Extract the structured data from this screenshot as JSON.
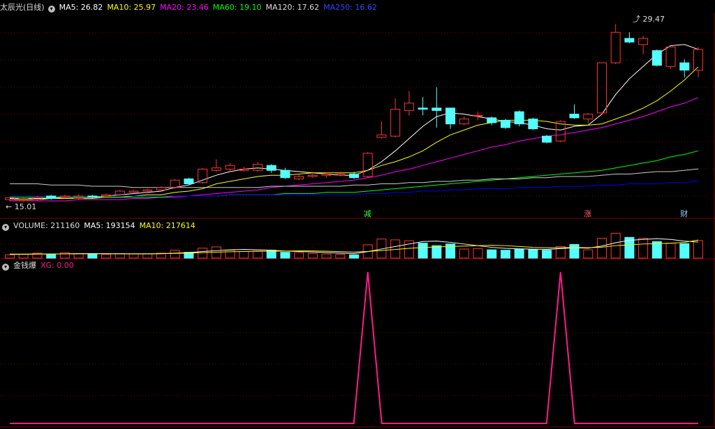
{
  "colors": {
    "bg": "#000000",
    "up": "#ff3232",
    "down": "#54ffff",
    "grid": "#7a0000",
    "ma5": "#ffffff",
    "ma10": "#ffff00",
    "ma20": "#ff00ff",
    "ma60": "#00ff00",
    "ma120": "#cccccc",
    "ma250": "#0000ff",
    "xg": "#ff1a8c",
    "evt_green": "#33ff33",
    "evt_red": "#ff6666",
    "evt_cyan": "#88ccff"
  },
  "price_header": {
    "title": "太辰光(日线)",
    "ma5": "MA5: 26.82",
    "ma10": "MA10: 25.97",
    "ma20": "MA20: 23.46",
    "ma60": "MA60: 19.10",
    "ma120": "MA120: 17.62",
    "ma250": "MA250: 16.62"
  },
  "volume_header": {
    "label": "VOLUME: 211160",
    "ma5": "MA5: 193154",
    "ma10": "MA10: 217614"
  },
  "indicator_header": {
    "label": "金钱爆",
    "xg": "XG: 0.00"
  },
  "annotations": {
    "high": "29.47",
    "low": "15.01"
  },
  "events": [
    {
      "label": "减",
      "index": 26,
      "color": "evt_green"
    },
    {
      "label": "涨",
      "index": 42,
      "color": "evt_red"
    },
    {
      "label": "财",
      "index": 49,
      "color": "evt_cyan"
    }
  ],
  "chart_data": {
    "type": "candlestick",
    "price_range": [
      14.6,
      30.3
    ],
    "volume_range": [
      0,
      320000
    ],
    "xg_range": [
      0,
      1
    ],
    "candles": [
      [
        15.1,
        15.25,
        14.95,
        15.3
      ],
      [
        15.0,
        15.2,
        14.9,
        15.3
      ],
      [
        15.1,
        15.3,
        15.0,
        15.4
      ],
      [
        15.4,
        15.2,
        15.1,
        15.5
      ],
      [
        15.3,
        15.4,
        15.2,
        15.5
      ],
      [
        15.2,
        15.4,
        15.1,
        15.5
      ],
      [
        15.4,
        15.3,
        15.2,
        15.5
      ],
      [
        15.4,
        15.5,
        15.3,
        15.6
      ],
      [
        15.5,
        15.8,
        15.4,
        15.9
      ],
      [
        15.7,
        15.8,
        15.6,
        15.9
      ],
      [
        15.8,
        15.9,
        15.6,
        16.0
      ],
      [
        15.9,
        16.1,
        15.8,
        16.2
      ],
      [
        16.1,
        16.7,
        16.0,
        16.8
      ],
      [
        16.8,
        16.4,
        16.3,
        16.9
      ],
      [
        16.5,
        17.6,
        16.4,
        17.7
      ],
      [
        17.5,
        17.7,
        17.4,
        18.4
      ],
      [
        17.6,
        17.9,
        17.4,
        18.1
      ],
      [
        17.5,
        17.6,
        17.4,
        17.8
      ],
      [
        17.5,
        18.0,
        17.4,
        18.2
      ],
      [
        17.9,
        17.5,
        17.3,
        18.0
      ],
      [
        17.5,
        16.9,
        16.8,
        17.7
      ],
      [
        16.8,
        17.0,
        16.7,
        17.2
      ],
      [
        17.0,
        17.1,
        16.9,
        17.2
      ],
      [
        17.1,
        17.2,
        16.9,
        17.3
      ],
      [
        17.1,
        17.2,
        17.0,
        17.4
      ],
      [
        17.2,
        16.9,
        16.8,
        17.4
      ],
      [
        17.0,
        18.9,
        16.9,
        19.0
      ],
      [
        20.2,
        20.4,
        20.1,
        21.5
      ],
      [
        20.3,
        22.5,
        20.2,
        23.4
      ],
      [
        22.4,
        23.0,
        22.0,
        24.0
      ],
      [
        22.6,
        22.5,
        22.0,
        23.5
      ],
      [
        22.6,
        22.4,
        21.0,
        24.3
      ],
      [
        22.6,
        21.3,
        20.9,
        22.6
      ],
      [
        21.3,
        21.7,
        21.2,
        21.9
      ],
      [
        22.0,
        22.0,
        21.6,
        22.3
      ],
      [
        21.8,
        21.4,
        21.2,
        21.9
      ],
      [
        21.6,
        21.0,
        20.9,
        21.7
      ],
      [
        22.3,
        21.3,
        21.1,
        22.4
      ],
      [
        21.7,
        20.9,
        20.8,
        21.8
      ],
      [
        20.3,
        19.8,
        19.7,
        20.4
      ],
      [
        19.9,
        21.5,
        19.8,
        21.6
      ],
      [
        22.1,
        21.8,
        21.7,
        22.9
      ],
      [
        21.7,
        22.1,
        21.4,
        22.2
      ],
      [
        22.2,
        26.3,
        22.1,
        26.3
      ],
      [
        26.3,
        28.8,
        26.2,
        29.47
      ],
      [
        28.3,
        28.0,
        27.9,
        28.8
      ],
      [
        27.8,
        28.3,
        27.0,
        28.5
      ],
      [
        27.3,
        26.1,
        26.0,
        27.4
      ],
      [
        26.0,
        27.6,
        25.8,
        27.6
      ],
      [
        26.3,
        25.7,
        25.1,
        26.6
      ],
      [
        25.7,
        27.4,
        25.1,
        27.6
      ]
    ],
    "ma_series": [
      {
        "name": "MA5",
        "color": "ma5",
        "values": [
          15.2,
          15.2,
          15.2,
          15.2,
          15.3,
          15.3,
          15.3,
          15.4,
          15.5,
          15.6,
          15.7,
          15.8,
          16.1,
          16.3,
          16.7,
          17.1,
          17.4,
          17.6,
          17.7,
          17.6,
          17.5,
          17.4,
          17.3,
          17.2,
          17.1,
          17.1,
          17.5,
          18.2,
          19.1,
          20.1,
          21.1,
          21.9,
          22.2,
          22.1,
          21.9,
          21.7,
          21.5,
          21.4,
          21.2,
          20.9,
          20.8,
          21.1,
          21.2,
          22.1,
          23.7,
          25.0,
          26.0,
          27.0,
          27.7,
          27.8,
          27.4
        ]
      },
      {
        "name": "MA10",
        "color": "ma10",
        "values": [
          15.1,
          15.1,
          15.1,
          15.2,
          15.2,
          15.2,
          15.2,
          15.3,
          15.3,
          15.4,
          15.5,
          15.5,
          15.7,
          15.8,
          16.0,
          16.4,
          16.6,
          16.8,
          17.0,
          17.1,
          17.1,
          17.2,
          17.3,
          17.3,
          17.3,
          17.3,
          17.5,
          17.9,
          18.2,
          18.6,
          19.1,
          19.8,
          20.4,
          20.8,
          21.2,
          21.4,
          21.6,
          21.6,
          21.6,
          21.5,
          21.3,
          21.2,
          21.2,
          21.3,
          21.7,
          22.1,
          22.6,
          23.2,
          24.0,
          24.9,
          25.97
        ]
      },
      {
        "name": "MA20",
        "color": "ma20",
        "values": [
          15.0,
          15.0,
          15.0,
          15.0,
          15.0,
          15.1,
          15.1,
          15.1,
          15.1,
          15.2,
          15.2,
          15.3,
          15.3,
          15.4,
          15.5,
          15.6,
          15.7,
          15.8,
          15.9,
          16.1,
          16.2,
          16.3,
          16.4,
          16.5,
          16.6,
          16.7,
          16.9,
          17.1,
          17.4,
          17.6,
          17.9,
          18.2,
          18.5,
          18.8,
          19.1,
          19.4,
          19.6,
          19.9,
          20.1,
          20.3,
          20.4,
          20.6,
          20.8,
          21.0,
          21.3,
          21.6,
          21.9,
          22.3,
          22.7,
          23.0,
          23.46
        ]
      },
      {
        "name": "MA60",
        "color": "ma60",
        "values": [
          15.3,
          15.3,
          15.3,
          15.3,
          15.3,
          15.3,
          15.3,
          15.3,
          15.3,
          15.3,
          15.3,
          15.3,
          15.4,
          15.4,
          15.4,
          15.4,
          15.5,
          15.5,
          15.5,
          15.5,
          15.6,
          15.6,
          15.6,
          15.7,
          15.7,
          15.7,
          15.8,
          15.9,
          16.0,
          16.1,
          16.2,
          16.3,
          16.4,
          16.5,
          16.6,
          16.7,
          16.8,
          16.9,
          17.0,
          17.1,
          17.2,
          17.3,
          17.4,
          17.5,
          17.7,
          17.9,
          18.1,
          18.3,
          18.6,
          18.8,
          19.1
        ]
      },
      {
        "name": "MA120",
        "color": "ma120",
        "values": [
          16.4,
          16.4,
          16.4,
          16.3,
          16.3,
          16.3,
          16.2,
          16.2,
          16.2,
          16.1,
          16.1,
          16.1,
          16.1,
          16.1,
          16.1,
          16.1,
          16.1,
          16.1,
          16.1,
          16.2,
          16.2,
          16.2,
          16.2,
          16.2,
          16.2,
          16.3,
          16.3,
          16.4,
          16.4,
          16.5,
          16.5,
          16.6,
          16.6,
          16.7,
          16.7,
          16.8,
          16.8,
          16.8,
          16.9,
          16.9,
          17.0,
          17.0,
          17.0,
          17.1,
          17.2,
          17.2,
          17.3,
          17.4,
          17.4,
          17.5,
          17.62
        ]
      },
      {
        "name": "MA250",
        "color": "ma250",
        "values": [
          15.4,
          15.4,
          15.4,
          15.4,
          15.4,
          15.4,
          15.4,
          15.4,
          15.4,
          15.4,
          15.4,
          15.4,
          15.4,
          15.4,
          15.4,
          15.4,
          15.5,
          15.5,
          15.5,
          15.5,
          15.5,
          15.5,
          15.5,
          15.5,
          15.5,
          15.5,
          15.6,
          15.6,
          15.7,
          15.7,
          15.8,
          15.8,
          15.9,
          15.9,
          16.0,
          16.0,
          16.0,
          16.1,
          16.1,
          16.1,
          16.2,
          16.2,
          16.2,
          16.3,
          16.3,
          16.4,
          16.4,
          16.4,
          16.5,
          16.5,
          16.62
        ]
      }
    ],
    "volume": [
      40000,
      45000,
      60000,
      50000,
      65000,
      55000,
      50000,
      45000,
      55000,
      50000,
      50000,
      60000,
      95000,
      70000,
      120000,
      135000,
      95000,
      80000,
      85000,
      95000,
      70000,
      65000,
      55000,
      50000,
      45000,
      40000,
      160000,
      230000,
      220000,
      210000,
      180000,
      150000,
      170000,
      110000,
      115000,
      100000,
      95000,
      110000,
      105000,
      95000,
      140000,
      165000,
      100000,
      240000,
      300000,
      250000,
      240000,
      200000,
      180000,
      175000,
      211160
    ],
    "vol_ma5": [
      45000,
      46000,
      48000,
      50000,
      52000,
      54000,
      55000,
      53000,
      52000,
      51000,
      52000,
      53000,
      60000,
      66000,
      80000,
      90000,
      100000,
      105000,
      100000,
      95000,
      85000,
      80000,
      74000,
      67000,
      60000,
      55000,
      78000,
      110000,
      140000,
      170000,
      200000,
      205000,
      190000,
      170000,
      150000,
      130000,
      118000,
      112000,
      108000,
      105000,
      115000,
      125000,
      120000,
      145000,
      185000,
      215000,
      225000,
      235000,
      225000,
      205000,
      193154
    ],
    "vol_ma10": [
      48000,
      48000,
      49000,
      50000,
      51000,
      52000,
      53000,
      53000,
      53000,
      53000,
      53000,
      54000,
      57000,
      60000,
      65000,
      72000,
      77000,
      80000,
      82000,
      83000,
      85000,
      87000,
      86000,
      83000,
      78000,
      73000,
      80000,
      92000,
      104000,
      118000,
      128000,
      135000,
      140000,
      145000,
      150000,
      155000,
      150000,
      140000,
      130000,
      125000,
      125000,
      128000,
      125000,
      132000,
      150000,
      160000,
      170000,
      175000,
      180000,
      190000,
      217614
    ],
    "xg": [
      0,
      0,
      0,
      0,
      0,
      0,
      0,
      0,
      0,
      0,
      0,
      0,
      0,
      0,
      0,
      0,
      0,
      0,
      0,
      0,
      0,
      0,
      0,
      0,
      0,
      0,
      1,
      0,
      0,
      0,
      0,
      0,
      0,
      0,
      0,
      0,
      0,
      0,
      0,
      0,
      1,
      0,
      0,
      0,
      0,
      0,
      0,
      0,
      0,
      0,
      0
    ]
  }
}
